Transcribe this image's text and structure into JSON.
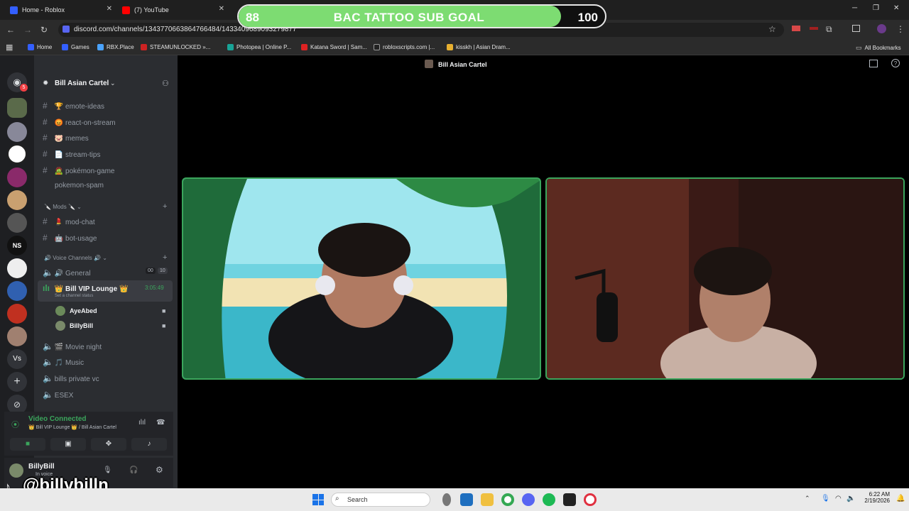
{
  "browser": {
    "tabs": [
      {
        "title": "Home - Roblox"
      },
      {
        "title": "(7) YouTube"
      }
    ],
    "url": "discord.com/channels/1343770663864766484/1433409689093279877",
    "bookmarks": [
      {
        "label": "Home"
      },
      {
        "label": "Games"
      },
      {
        "label": "RBX.Place"
      },
      {
        "label": "STEAMUNLOCKED »..."
      },
      {
        "label": "Photopea | Online P..."
      },
      {
        "label": "Katana Sword | Sam..."
      },
      {
        "label": "robloxscripts.com |..."
      },
      {
        "label": "kisskh | Asian Dram..."
      }
    ],
    "all_bookmarks": "All Bookmarks"
  },
  "goal": {
    "current": "88",
    "title": "BAC TATTOO SUB GOAL",
    "max": "100",
    "progress": 0.88
  },
  "discord": {
    "server_name": "Bill Asian Cartel",
    "dm_badge": "5",
    "channels": [
      {
        "label": "🏆 emote-ideas"
      },
      {
        "label": "😡 react-on-stream"
      },
      {
        "label": "🐷 memes"
      },
      {
        "label": "📄 stream-tips"
      },
      {
        "label": "🧟 pokémon-game"
      },
      {
        "label": "pokemon-spam"
      }
    ],
    "mods_category": "Mods",
    "mod_channels": [
      {
        "label": "💄 mod-chat"
      },
      {
        "label": "🤖 bot-usage"
      }
    ],
    "voice_category": "Voice Channels",
    "voice_channels": [
      {
        "label": "🔊 General",
        "count_a": "00",
        "count_b": "10"
      },
      {
        "label": "👑 Bill VIP Lounge 👑",
        "time": "3:05:49",
        "status": "Set a channel status"
      },
      {
        "label": "🎬 Movie night"
      },
      {
        "label": "🎵 Music"
      },
      {
        "label": "bills private vc"
      },
      {
        "label": "ESEX"
      }
    ],
    "members": [
      "AyeAbed",
      "BillyBill"
    ],
    "voice_status": "Video Connected",
    "voice_location": "👑 Bill VIP Lounge 👑 / Bill Asian Cartel",
    "user": {
      "name": "BillyBill",
      "status": "In voice"
    },
    "title": "Bill Asian Cartel",
    "server_letters": {
      "ns": "NS",
      "vs": "Vs"
    }
  },
  "taskbar": {
    "search_placeholder": "Search",
    "time": "6:22 AM",
    "date": "2/19/2026"
  },
  "watermark": "@billybilln"
}
